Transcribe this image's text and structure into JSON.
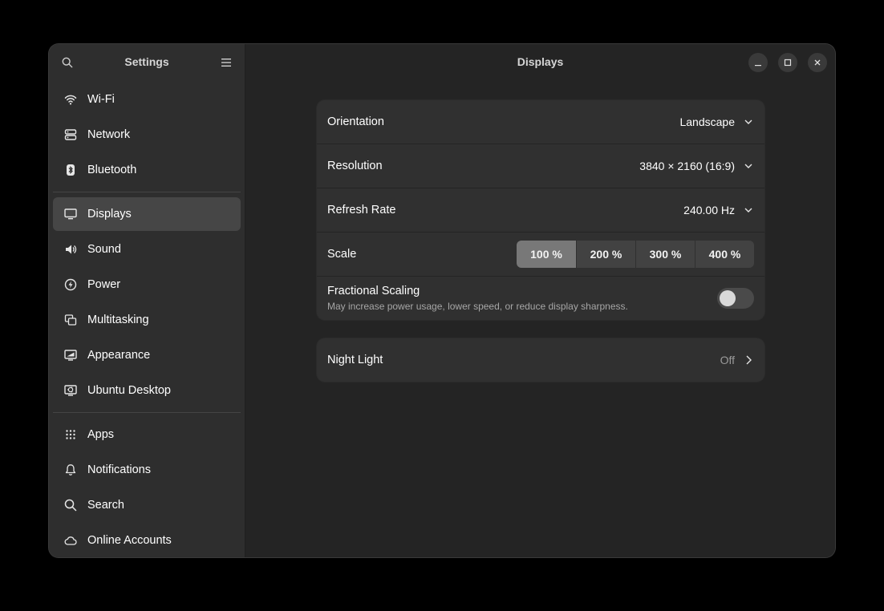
{
  "sidebar": {
    "title": "Settings",
    "items": [
      {
        "label": "Wi-Fi",
        "icon": "wifi-icon"
      },
      {
        "label": "Network",
        "icon": "network-icon"
      },
      {
        "label": "Bluetooth",
        "icon": "bluetooth-icon"
      },
      {
        "label": "Displays",
        "icon": "display-icon",
        "active": true
      },
      {
        "label": "Sound",
        "icon": "speaker-icon"
      },
      {
        "label": "Power",
        "icon": "power-icon"
      },
      {
        "label": "Multitasking",
        "icon": "multitasking-icon"
      },
      {
        "label": "Appearance",
        "icon": "appearance-icon"
      },
      {
        "label": "Ubuntu Desktop",
        "icon": "ubuntu-desktop-icon"
      },
      {
        "label": "Apps",
        "icon": "apps-grid-icon"
      },
      {
        "label": "Notifications",
        "icon": "bell-icon"
      },
      {
        "label": "Search",
        "icon": "search-icon"
      },
      {
        "label": "Online Accounts",
        "icon": "cloud-icon"
      }
    ]
  },
  "main": {
    "title": "Displays",
    "orientation": {
      "label": "Orientation",
      "value": "Landscape"
    },
    "resolution": {
      "label": "Resolution",
      "value": "3840 × 2160 (16:9)"
    },
    "refresh": {
      "label": "Refresh Rate",
      "value": "240.00 Hz"
    },
    "scale": {
      "label": "Scale",
      "options": [
        "100 %",
        "200 %",
        "300 %",
        "400 %"
      ],
      "selected": "100 %"
    },
    "fractional": {
      "title": "Fractional Scaling",
      "subtitle": "May increase power usage, lower speed, or reduce display sharpness.",
      "enabled": false
    },
    "night_light": {
      "label": "Night Light",
      "value": "Off"
    }
  },
  "colors": {
    "window_bg": "#242424",
    "sidebar_bg": "#2e2e2e",
    "card_bg": "#303030",
    "active_item": "#464646",
    "segment_active": "#787878"
  }
}
